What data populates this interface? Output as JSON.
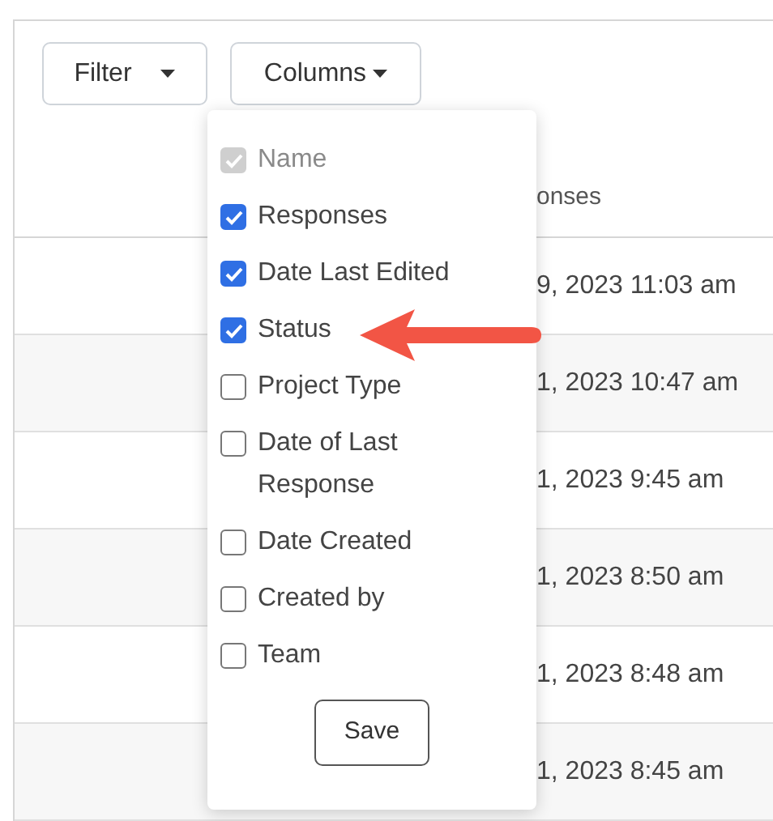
{
  "toolbar": {
    "filter_button": "Filter",
    "columns_button": "Columns"
  },
  "table": {
    "header": "onses",
    "rows": [
      {
        "column_2": "9, 2023 11:03 am"
      },
      {
        "column_2": "1, 2023 10:47 am"
      },
      {
        "column_2": "1, 2023 9:45 am"
      },
      {
        "column_2": "1, 2023 8:50 am"
      },
      {
        "column_2": "1, 2023 8:48 am"
      },
      {
        "column_2": "1, 2023 8:45 am"
      }
    ]
  },
  "columns_menu": {
    "items": [
      {
        "label": "Name",
        "checked": true,
        "disabled": true
      },
      {
        "label": "Responses",
        "checked": true,
        "disabled": false
      },
      {
        "label": "Date Last Edited",
        "checked": true,
        "disabled": false
      },
      {
        "label": "Status",
        "checked": true,
        "disabled": false
      },
      {
        "label": "Project Type",
        "checked": false,
        "disabled": false
      },
      {
        "label": "Date of Last Response",
        "checked": false,
        "disabled": false
      },
      {
        "label": "Date Created",
        "checked": false,
        "disabled": false
      },
      {
        "label": "Created by",
        "checked": false,
        "disabled": false
      },
      {
        "label": "Team",
        "checked": false,
        "disabled": false
      }
    ],
    "save_button": "Save"
  }
}
